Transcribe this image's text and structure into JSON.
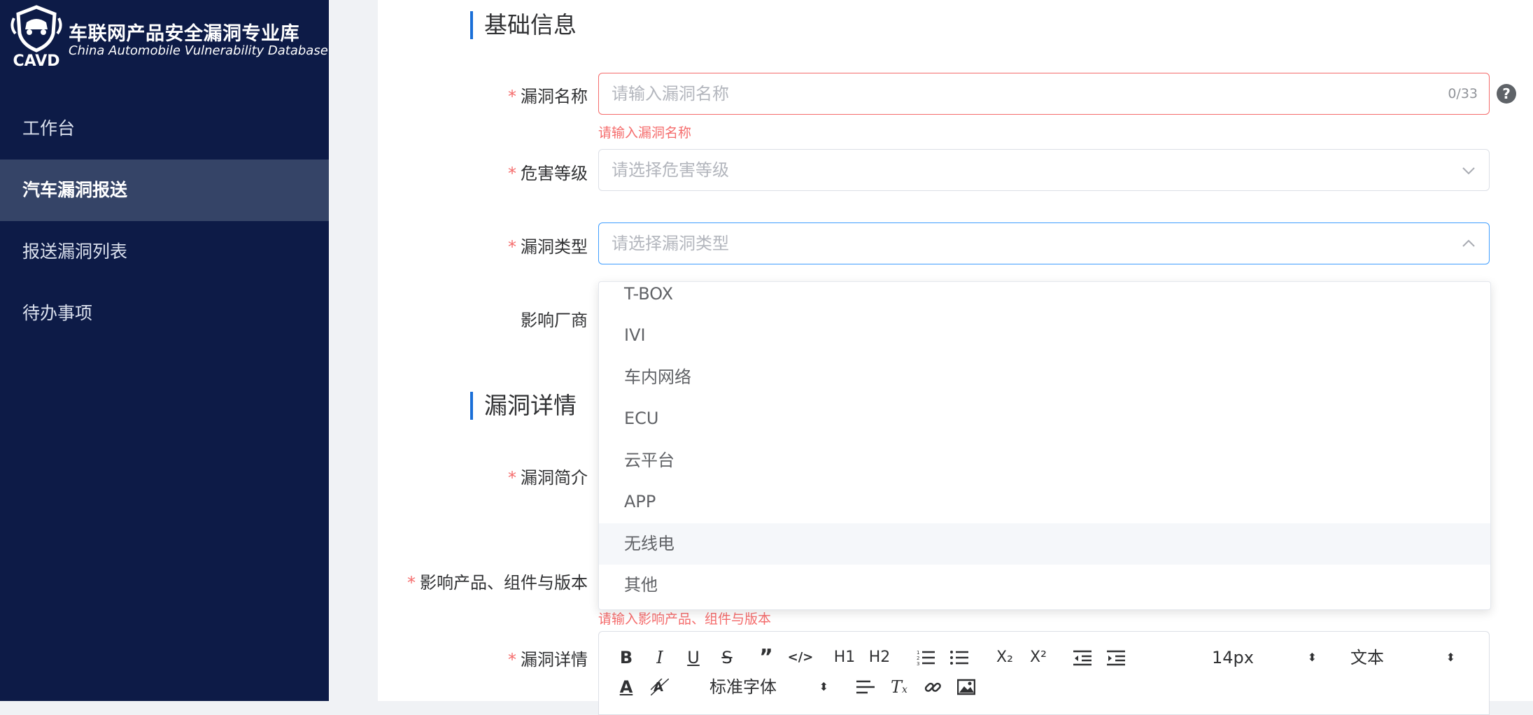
{
  "brand": {
    "name_cn": "车联网产品安全漏洞专业库",
    "name_en": "China Automobile Vulnerability Database",
    "abbr": "CAVD"
  },
  "sidebar": {
    "items": [
      {
        "label": "工作台",
        "active": false
      },
      {
        "label": "汽车漏洞报送",
        "active": true
      },
      {
        "label": "报送漏洞列表",
        "active": false
      },
      {
        "label": "待办事项",
        "active": false
      }
    ]
  },
  "form": {
    "section_basic": "基础信息",
    "section_detail": "漏洞详情",
    "required_mark": "*",
    "vuln_name": {
      "label": "漏洞名称",
      "placeholder": "请输入漏洞名称",
      "counter": "0/33",
      "error": "请输入漏洞名称"
    },
    "severity": {
      "label": "危害等级",
      "placeholder": "请选择危害等级"
    },
    "vuln_type": {
      "label": "漏洞类型",
      "placeholder": "请选择漏洞类型",
      "options": [
        "T-BOX",
        "IVI",
        "车内网络",
        "ECU",
        "云平台",
        "APP",
        "无线电",
        "其他"
      ],
      "hovered_option": "无线电"
    },
    "vendor": {
      "label": "影响厂商"
    },
    "summary": {
      "label": "漏洞简介"
    },
    "products": {
      "label": "影响产品、组件与版本",
      "error": "请输入影响产品、组件与版本"
    },
    "details": {
      "label": "漏洞详情",
      "toolbar": {
        "font_size": "14px",
        "block_type": "文本",
        "font_family": "标准字体",
        "h1": "H1",
        "h2": "H2",
        "subscript": "X₂",
        "superscript": "X²"
      }
    }
  },
  "colors": {
    "sidebar_bg": "#0d1b47",
    "sidebar_active": "#354467",
    "accent": "#1a6fd8",
    "error": "#f56c6c",
    "focus": "#409eff"
  }
}
